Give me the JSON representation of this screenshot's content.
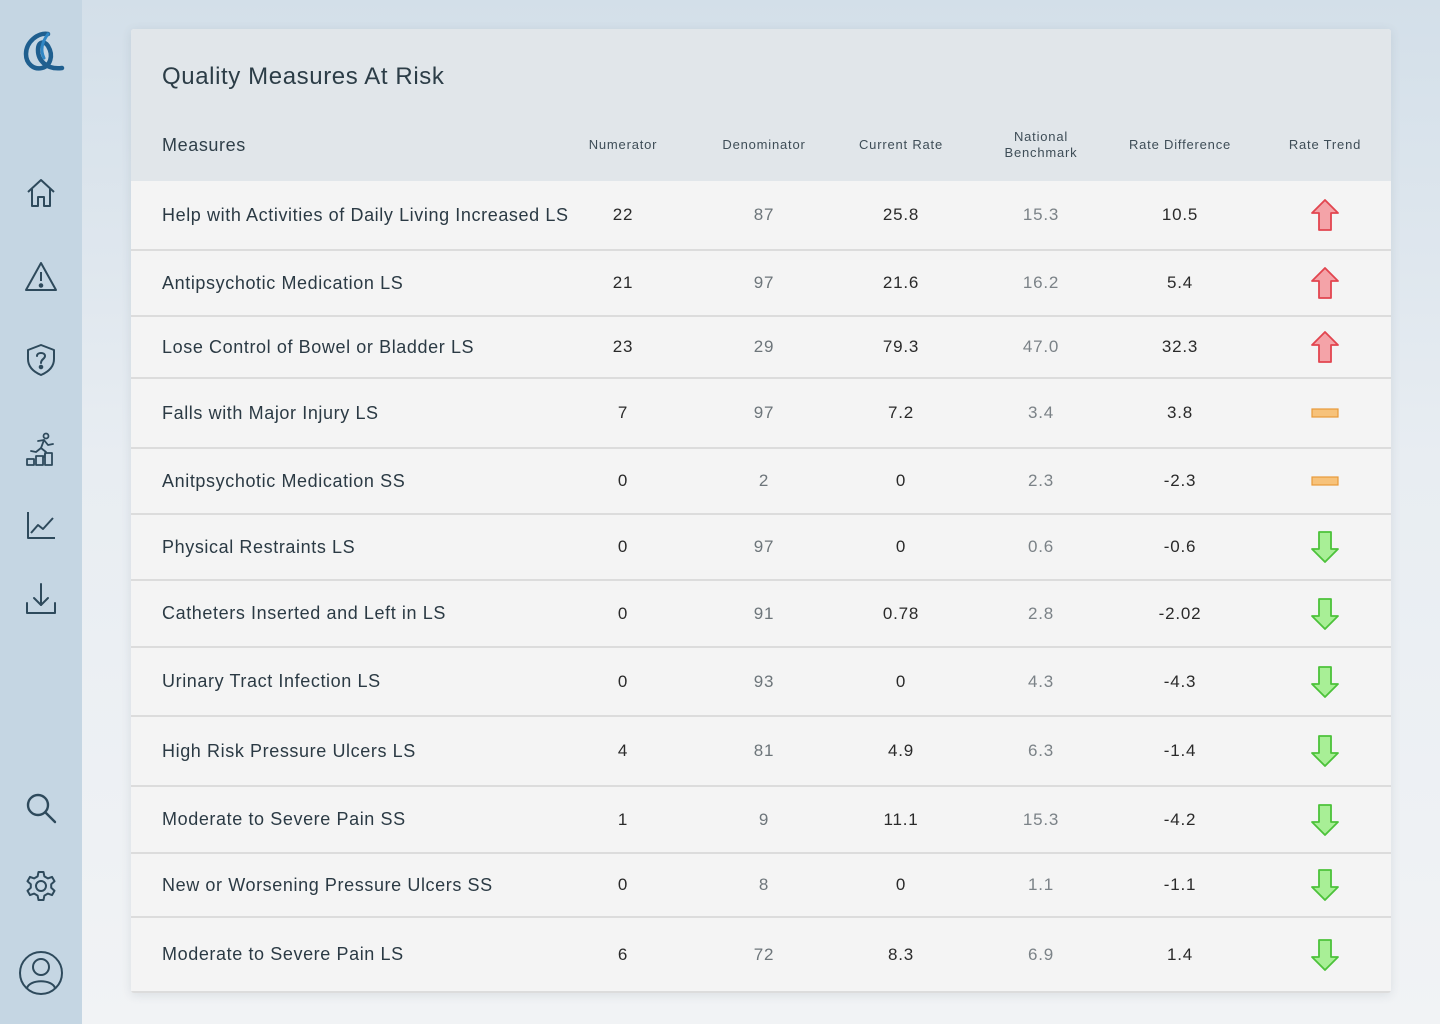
{
  "card": {
    "title": "Quality Measures At Risk"
  },
  "columns": {
    "measures": "Measures",
    "numerator": "Numerator",
    "denominator": "Denominator",
    "current_rate": "Current Rate",
    "benchmark_line1": "National",
    "benchmark_line2": "Benchmark",
    "rate_difference": "Rate Difference",
    "rate_trend": "Rate Trend"
  },
  "colors": {
    "up": "#f4a3a8",
    "up_stroke": "#e2454f",
    "flat": "#f7c27a",
    "flat_stroke": "#e89a3a",
    "down": "#a8ef96",
    "down_stroke": "#4cc23a"
  },
  "sidebar": {
    "logo": "logo-icon",
    "items": [
      "home-icon",
      "warning-icon",
      "shield-question-icon",
      "progress-runner-icon",
      "line-chart-icon",
      "download-icon"
    ],
    "bottom": [
      "search-icon",
      "gear-icon",
      "user-avatar-icon"
    ]
  },
  "rows": [
    {
      "measure": "Help with Activities of Daily Living Increased LS",
      "numerator": "22",
      "denominator": "87",
      "current_rate": "25.8",
      "benchmark": "15.3",
      "difference": "10.5",
      "trend": "up"
    },
    {
      "measure": "Antipsychotic Medication LS",
      "numerator": "21",
      "denominator": "97",
      "current_rate": "21.6",
      "benchmark": "16.2",
      "difference": "5.4",
      "trend": "up"
    },
    {
      "measure": "Lose Control of Bowel or Bladder LS",
      "numerator": "23",
      "denominator": "29",
      "current_rate": "79.3",
      "benchmark": "47.0",
      "difference": "32.3",
      "trend": "up"
    },
    {
      "measure": "Falls with Major Injury LS",
      "numerator": "7",
      "denominator": "97",
      "current_rate": "7.2",
      "benchmark": "3.4",
      "difference": "3.8",
      "trend": "flat"
    },
    {
      "measure": "Anitpsychotic Medication SS",
      "numerator": "0",
      "denominator": "2",
      "current_rate": "0",
      "benchmark": "2.3",
      "difference": "-2.3",
      "trend": "flat"
    },
    {
      "measure": "Physical Restraints LS",
      "numerator": "0",
      "denominator": "97",
      "current_rate": "0",
      "benchmark": "0.6",
      "difference": "-0.6",
      "trend": "down"
    },
    {
      "measure": "Catheters Inserted and Left in LS",
      "numerator": "0",
      "denominator": "91",
      "current_rate": "0.78",
      "benchmark": "2.8",
      "difference": "-2.02",
      "trend": "down"
    },
    {
      "measure": "Urinary Tract Infection LS",
      "numerator": "0",
      "denominator": "93",
      "current_rate": "0",
      "benchmark": "4.3",
      "difference": "-4.3",
      "trend": "down"
    },
    {
      "measure": "High Risk Pressure Ulcers LS",
      "numerator": "4",
      "denominator": "81",
      "current_rate": "4.9",
      "benchmark": "6.3",
      "difference": "-1.4",
      "trend": "down"
    },
    {
      "measure": "Moderate to Severe Pain SS",
      "numerator": "1",
      "denominator": "9",
      "current_rate": "11.1",
      "benchmark": "15.3",
      "difference": "-4.2",
      "trend": "down"
    },
    {
      "measure": "New or Worsening Pressure Ulcers SS",
      "numerator": "0",
      "denominator": "8",
      "current_rate": "0",
      "benchmark": "1.1",
      "difference": "-1.1",
      "trend": "down"
    },
    {
      "measure": "Moderate to Severe Pain LS",
      "numerator": "6",
      "denominator": "72",
      "current_rate": "8.3",
      "benchmark": "6.9",
      "difference": "1.4",
      "trend": "down"
    }
  ]
}
